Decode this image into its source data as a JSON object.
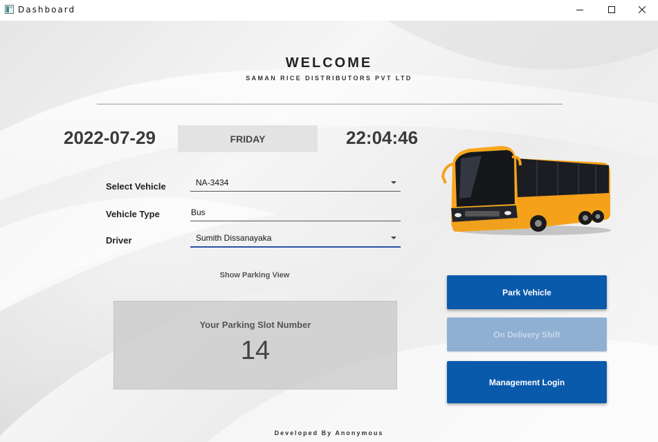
{
  "window": {
    "title": "Dashboard"
  },
  "header": {
    "welcome": "WELCOME",
    "company": "SAMAN RICE DISTRIBUTORS PVT LTD"
  },
  "clock": {
    "date": "2022-07-29",
    "day": "FRIDAY",
    "time": "22:04:46"
  },
  "form": {
    "vehicle_label": "Select Vehicle",
    "vehicle_value": "NA-3434",
    "type_label": "Vehicle Type",
    "type_value": "Bus",
    "driver_label": "Driver",
    "driver_value": "Sumith Dissanayaka"
  },
  "parking": {
    "show_link": "Show Parking View",
    "slot_title": "Your Parking Slot Number",
    "slot_number": "14"
  },
  "actions": {
    "park": "Park Vehicle",
    "delivery": "On Delivery Shift",
    "management": "Management Login"
  },
  "footer": {
    "credit": "Developed By Anonymous"
  },
  "colors": {
    "primary_button": "#0a5aab",
    "disabled_button": "#8fb0d3",
    "bus_body": "#f5a11a"
  },
  "icons": {
    "app": "app-window-icon",
    "minimize": "minimize-icon",
    "maximize": "maximize-icon",
    "close": "close-icon",
    "bus": "bus-image"
  }
}
